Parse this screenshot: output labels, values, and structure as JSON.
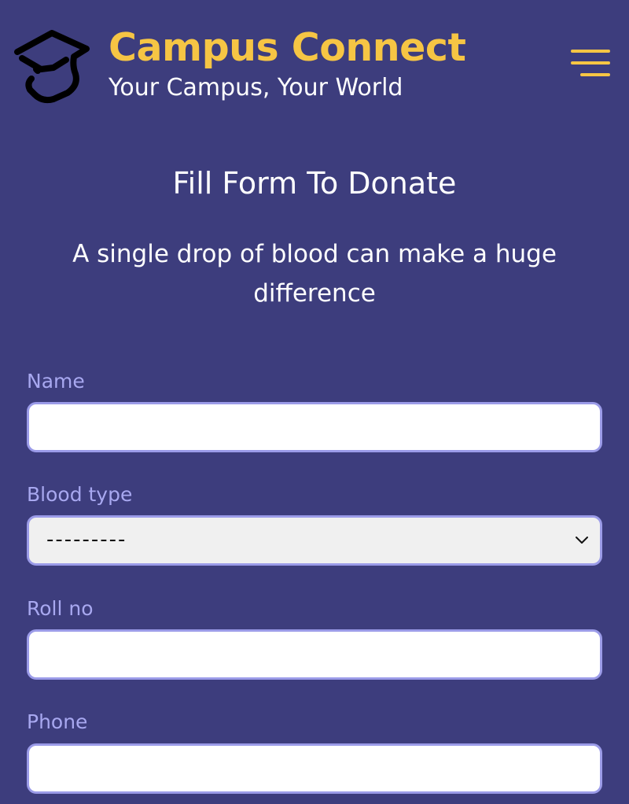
{
  "header": {
    "brand_title": "Campus Connect",
    "tagline": "Your Campus, Your World",
    "logo_icon": "graduation-cap-icon",
    "menu_icon": "hamburger-menu-icon"
  },
  "form": {
    "title": "Fill Form To Donate",
    "subtitle": "A single drop of blood can make a huge difference",
    "fields": {
      "name": {
        "label": "Name",
        "value": ""
      },
      "blood_type": {
        "label": "Blood type",
        "value": "---------"
      },
      "roll_no": {
        "label": "Roll no",
        "value": ""
      },
      "phone": {
        "label": "Phone",
        "value": ""
      }
    }
  },
  "colors": {
    "background": "#3d3d7d",
    "accent": "#f6c544",
    "label": "#a8a8f0",
    "input_border": "#9b9be8"
  }
}
